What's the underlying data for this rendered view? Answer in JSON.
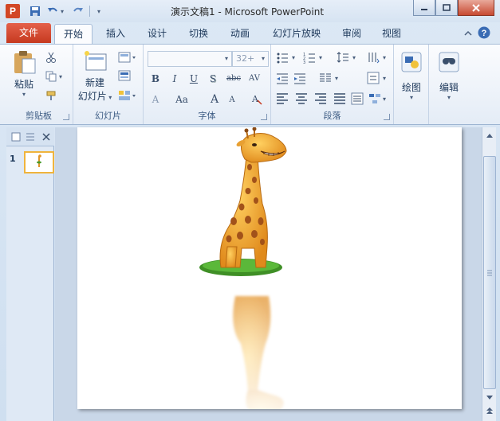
{
  "window": {
    "title": "演示文稿1 - Microsoft PowerPoint",
    "app_icon_letter": "P"
  },
  "tabs": {
    "file": "文件",
    "items": [
      "开始",
      "插入",
      "设计",
      "切换",
      "动画",
      "幻灯片放映",
      "审阅",
      "视图"
    ],
    "active": "开始"
  },
  "ribbon": {
    "clipboard": {
      "paste": "粘贴",
      "label": "剪贴板"
    },
    "slides": {
      "new_slide_line1": "新建",
      "new_slide_line2": "幻灯片",
      "label": "幻灯片"
    },
    "font": {
      "font_name": "",
      "font_size": "32+",
      "label": "字体",
      "buttons": [
        "B",
        "I",
        "U",
        "S",
        "abc",
        "AV",
        "A",
        "Aa",
        "A",
        "A"
      ]
    },
    "paragraph": {
      "label": "段落"
    },
    "drawing": {
      "label": "绘图"
    },
    "editing": {
      "label": "编辑"
    }
  },
  "slides_pane": {
    "slide_number": "1"
  },
  "colors": {
    "file_tab": "#d24726",
    "accent": "#1e395b",
    "ribbon_bg": "#fbfcfe"
  }
}
